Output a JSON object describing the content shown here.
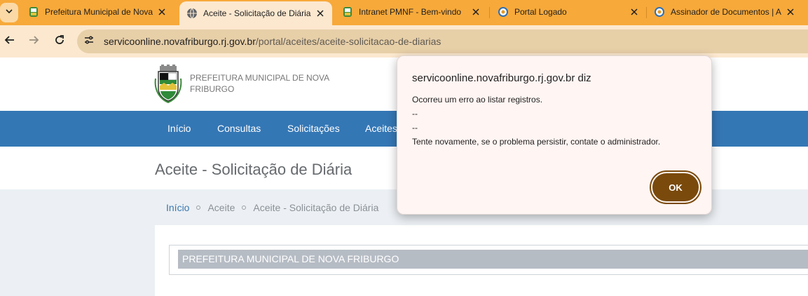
{
  "tabs": [
    {
      "title": "Prefeitura Municipal de Nova",
      "favicon": "municipal-crest-icon",
      "active": false
    },
    {
      "title": "Aceite - Solicitação de Diária",
      "favicon": "globe-icon",
      "active": true
    },
    {
      "title": "Intranet PMNF - Bem-vindo",
      "favicon": "municipal-crest-icon",
      "active": false
    },
    {
      "title": "Portal Logado",
      "favicon": "circle-logo-icon",
      "active": false
    },
    {
      "title": "Assinador de Documentos | A",
      "favicon": "circle-logo-icon",
      "active": false
    }
  ],
  "address_bar": {
    "host": "servicoonline.novafriburgo.rj.gov.br",
    "path": "/portal/aceites/aceite-solicitacao-de-diarias"
  },
  "site": {
    "brand_line1": "PREFEITURA MUNICIPAL DE NOVA",
    "brand_line2": "FRIBURGO"
  },
  "nav": {
    "items": [
      "Início",
      "Consultas",
      "Solicitações",
      "Aceites"
    ]
  },
  "page": {
    "title": "Aceite - Solicitação de Diária",
    "breadcrumb": [
      "Início",
      "Aceite",
      "Aceite - Solicitação de Diária"
    ],
    "panel_header": "PREFEITURA MUNICIPAL DE NOVA FRIBURGO"
  },
  "dialog": {
    "title": "servicoonline.novafriburgo.rj.gov.br diz",
    "lines": [
      "Ocorreu um erro ao listar registros.",
      "--",
      "--",
      "Tente novamente, se o problema persistir, contate o administrador."
    ],
    "ok_label": "OK"
  },
  "colors": {
    "tabstrip": "#f7a93a",
    "toolbar": "#fce8cf",
    "navbar": "#3477b5",
    "ok_button": "#7a4a0c"
  }
}
